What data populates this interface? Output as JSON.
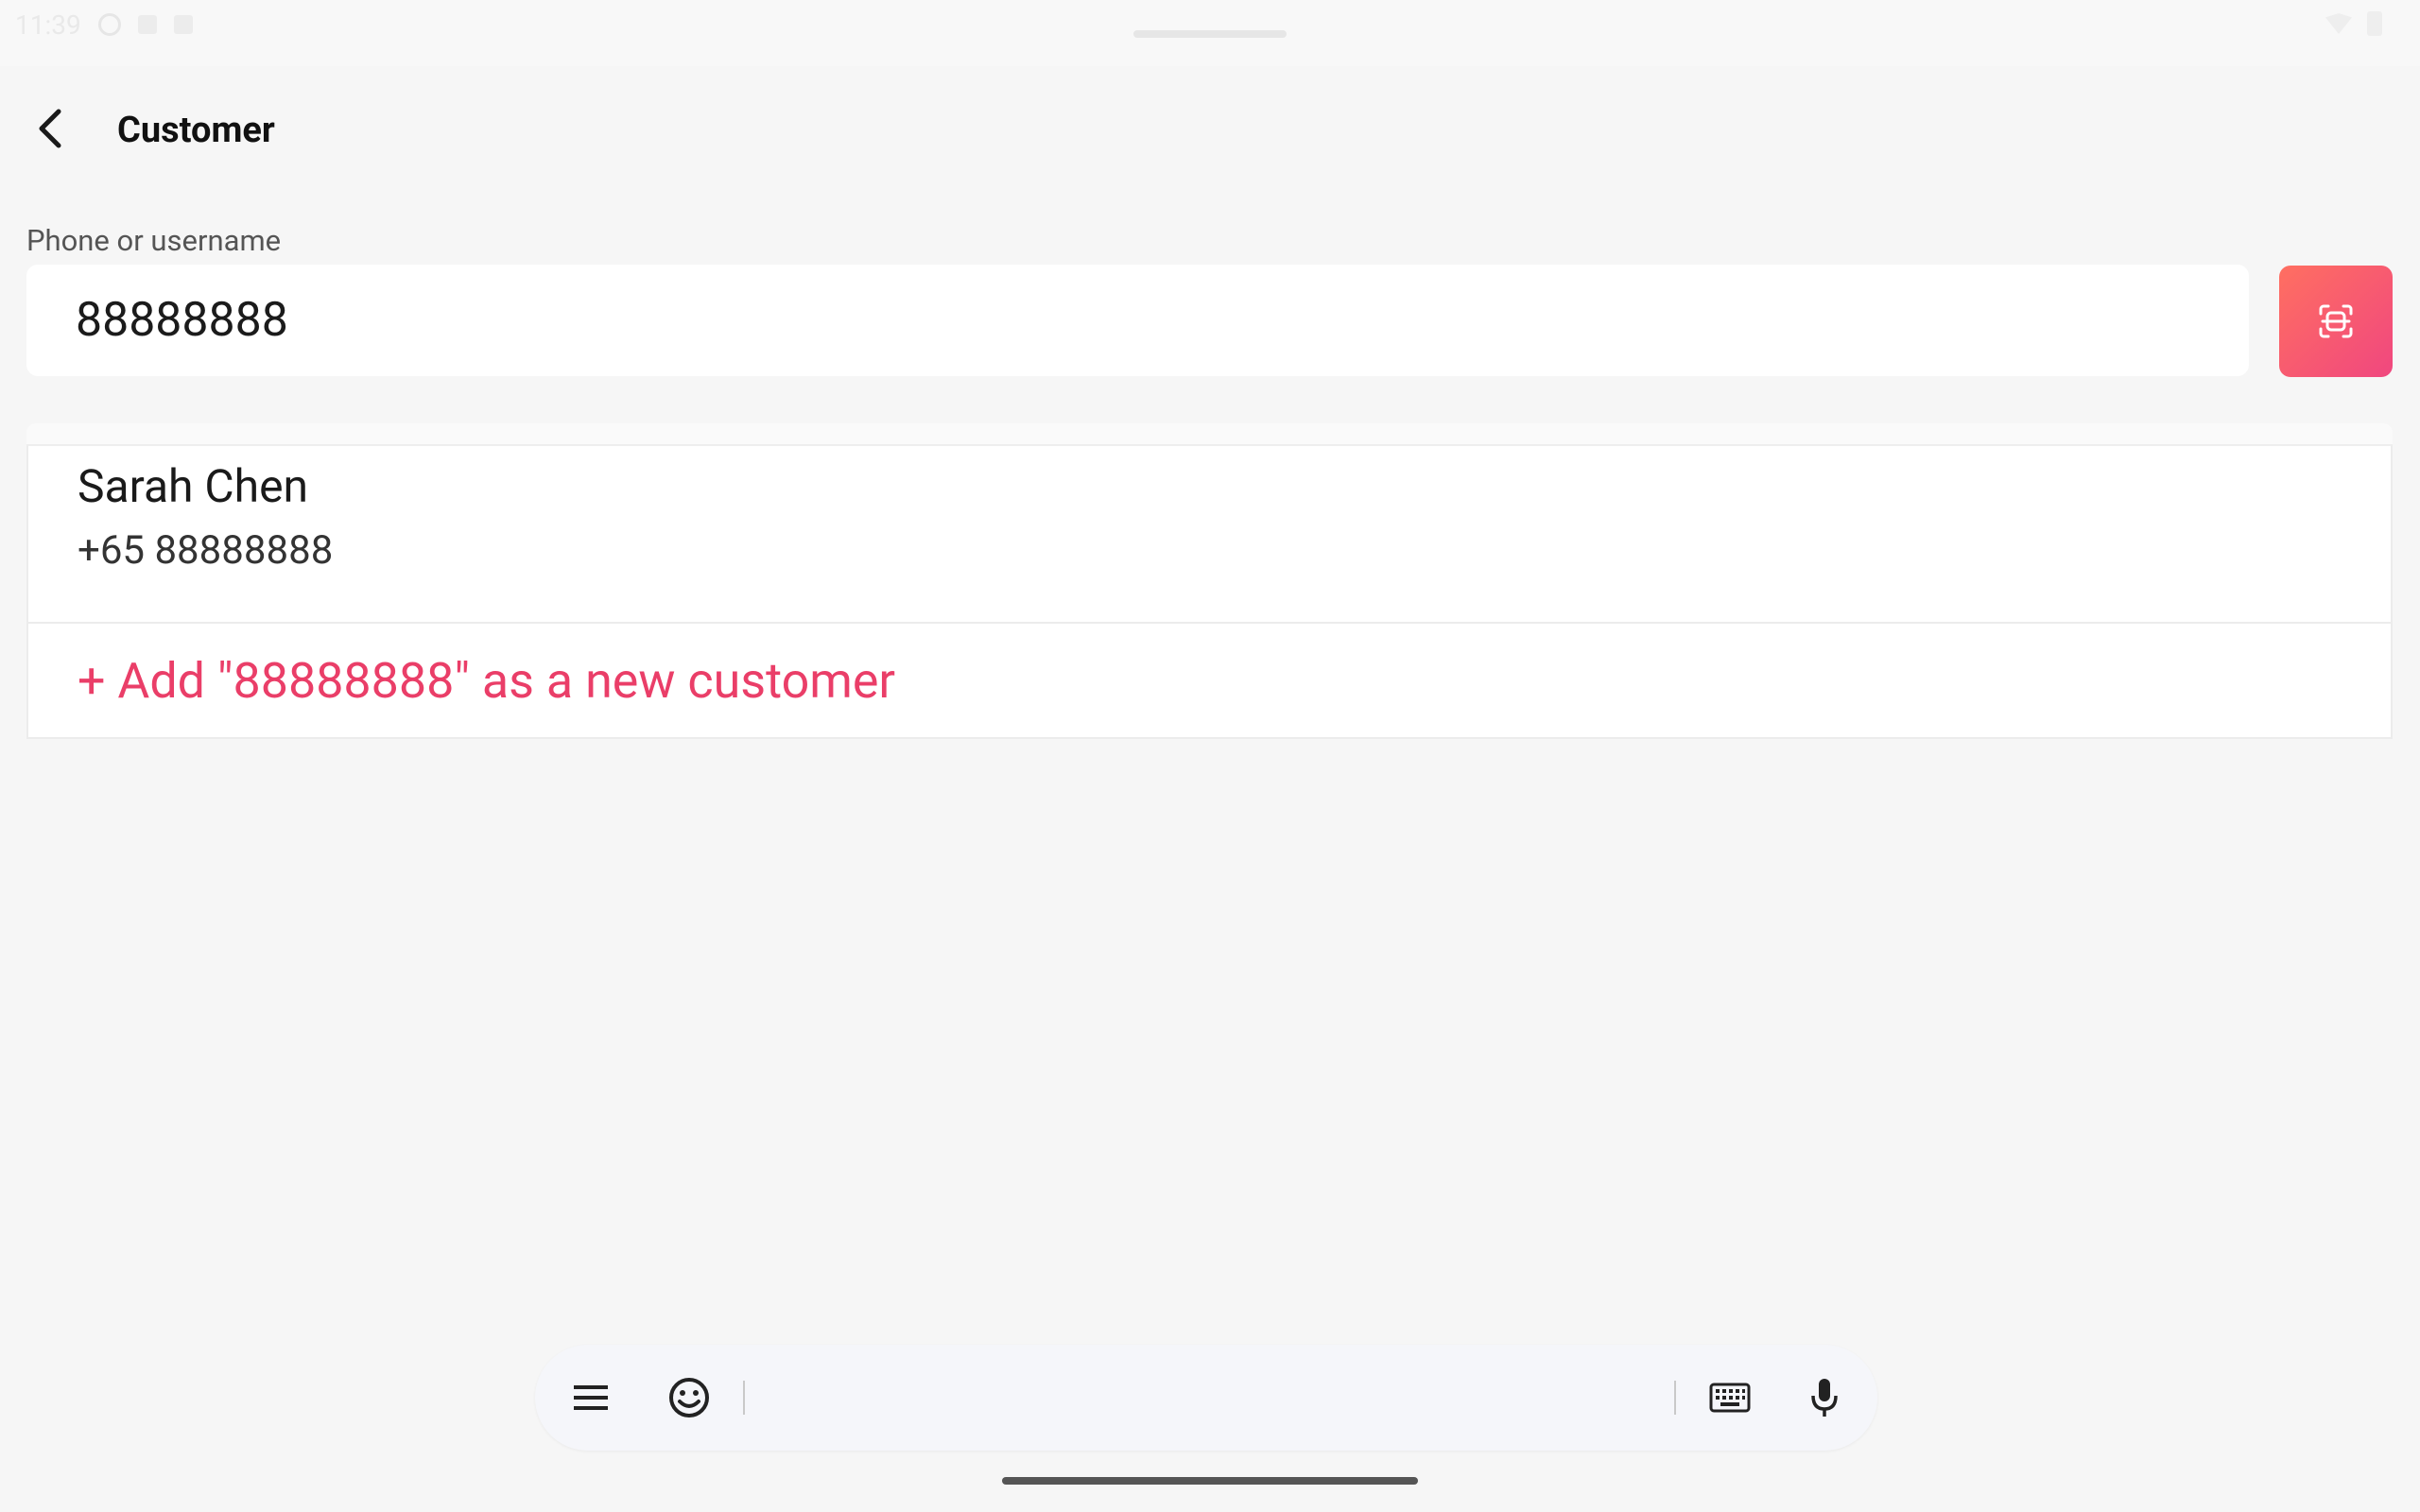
{
  "status_bar": {
    "time": "11:39"
  },
  "app_bar": {
    "title": "Customer",
    "back_icon": "chevron-left-icon"
  },
  "search": {
    "label": "Phone or username",
    "value": "88888888",
    "scan_icon": "scan-icon"
  },
  "results": {
    "customers": [
      {
        "name": "Sarah Chen",
        "phone": "+65 88888888"
      }
    ],
    "add_new_label": "+ Add \"88888888\" as a new customer"
  },
  "keyboard_toolbar": {
    "icons": [
      "menu-icon",
      "emoji-icon",
      "keyboard-icon",
      "microphone-icon"
    ]
  },
  "colors": {
    "accent": "#ea3e68",
    "scan_gradient_start": "#ff6f61",
    "scan_gradient_end": "#f0477f",
    "background": "#f6f6f6"
  }
}
